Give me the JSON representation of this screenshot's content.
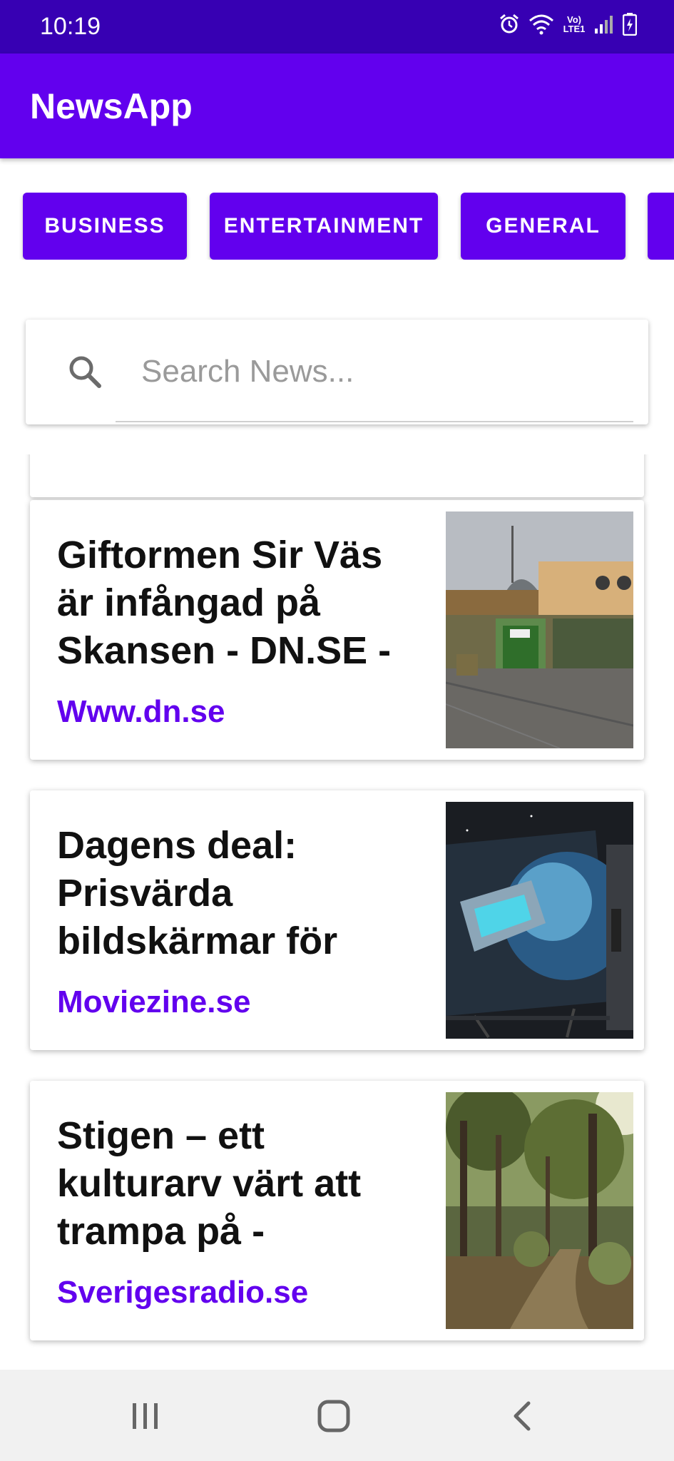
{
  "status_bar": {
    "time": "10:19",
    "network": "Vo) LTE1"
  },
  "app_bar": {
    "title": "NewsApp"
  },
  "categories": [
    {
      "label": "BUSINESS"
    },
    {
      "label": "ENTERTAINMENT"
    },
    {
      "label": "GENERAL"
    }
  ],
  "search": {
    "placeholder": "Search News...",
    "value": ""
  },
  "articles": [
    {
      "title": "Giftormen Sir Väs är infångad på Skansen - DN.SE -",
      "source": "Www.dn.se",
      "image": "building-entrance-photo"
    },
    {
      "title": "Dagens deal: Prisvärda bildskärmar för",
      "source": "Moviezine.se",
      "image": "monitor-spaceship-photo"
    },
    {
      "title": "Stigen – ett kulturarv värt att trampa på -",
      "source": "Sverigesradio.se",
      "image": "forest-path-photo"
    }
  ],
  "colors": {
    "primary": "#6200ee",
    "primary_dark": "#3700b3",
    "source_text": "#6200ee"
  },
  "nav_bar": {
    "icons": [
      "recent-apps-icon",
      "home-icon",
      "back-icon"
    ]
  }
}
